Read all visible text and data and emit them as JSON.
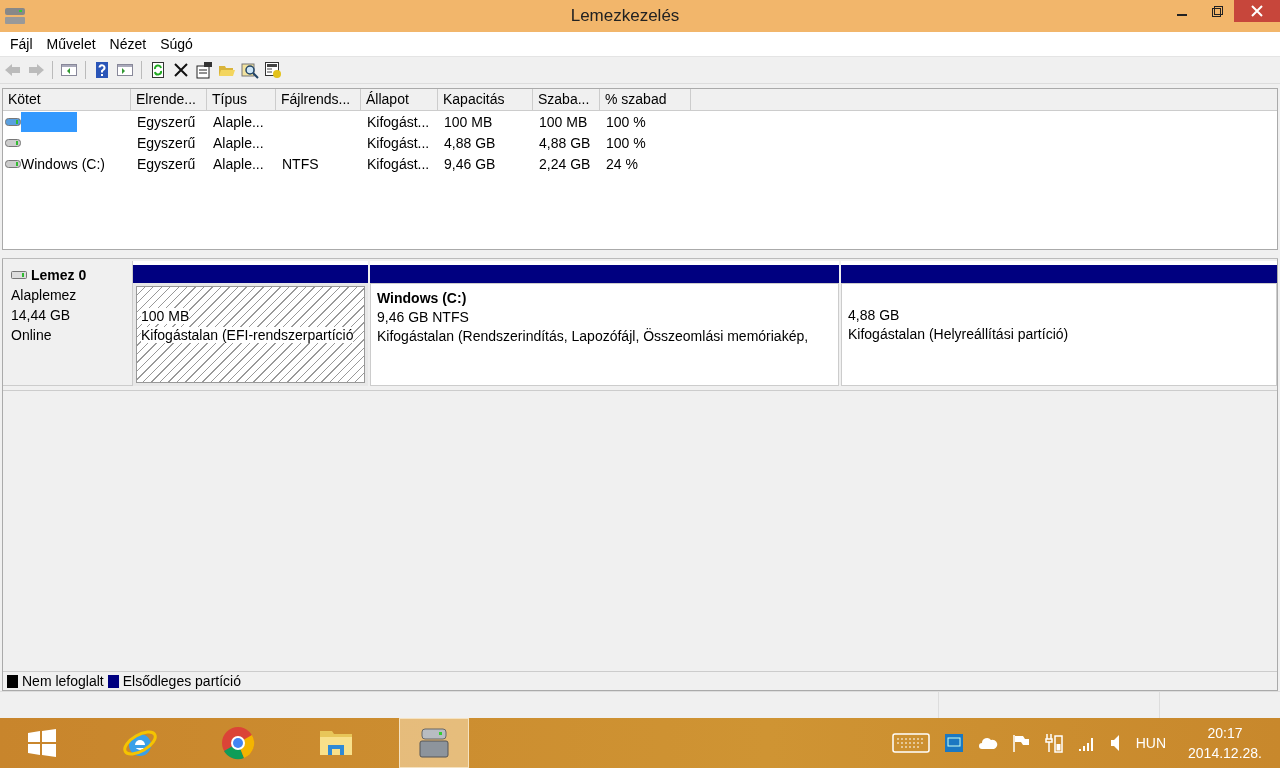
{
  "window": {
    "title": "Lemezkezelés"
  },
  "menu": [
    {
      "label": "Fájl"
    },
    {
      "label": "Művelet"
    },
    {
      "label": "Nézet"
    },
    {
      "label": "Súgó"
    }
  ],
  "toolbar": [
    {
      "kind": "back",
      "disabled": true
    },
    {
      "kind": "forward",
      "disabled": true
    },
    {
      "kind": "sep"
    },
    {
      "kind": "tree",
      "disabled": false
    },
    {
      "kind": "sep"
    },
    {
      "kind": "help",
      "disabled": false
    },
    {
      "kind": "pane",
      "disabled": false
    },
    {
      "kind": "sep"
    },
    {
      "kind": "refresh",
      "disabled": false
    },
    {
      "kind": "delete",
      "disabled": false
    },
    {
      "kind": "properties",
      "disabled": false
    },
    {
      "kind": "open",
      "disabled": false
    },
    {
      "kind": "explore",
      "disabled": false
    },
    {
      "kind": "helptopic",
      "disabled": false
    }
  ],
  "table": {
    "columns": [
      "Kötet",
      "Elrende...",
      "Típus",
      "Fájlrends...",
      "Állapot",
      "Kapacitás",
      "Szaba...",
      "% szabad"
    ],
    "rows": [
      {
        "selected": true,
        "cells": [
          "",
          "Egyszerű",
          "Alaple...",
          "",
          "Kifogást...",
          "100 MB",
          "100 MB",
          "100 %"
        ]
      },
      {
        "selected": false,
        "cells": [
          "",
          "Egyszerű",
          "Alaple...",
          "",
          "Kifogást...",
          "4,88 GB",
          "4,88 GB",
          "100 %"
        ]
      },
      {
        "selected": false,
        "cells": [
          "Windows (C:)",
          "Egyszerű",
          "Alaple...",
          "NTFS",
          "Kifogást...",
          "9,46 GB",
          "2,24 GB",
          "24 %"
        ]
      }
    ]
  },
  "disk": {
    "name": "Lemez 0",
    "type": "Alaplemez",
    "size": "14,44 GB",
    "status": "Online",
    "partitions": [
      {
        "selected": true,
        "color": "#000080",
        "size": "100 MB",
        "status": "Kifogástalan (EFI-rendszerpartíció"
      },
      {
        "selected": false,
        "color": "#000080",
        "name": "Windows  (C:)",
        "size": "9,46 GB NTFS",
        "status": "Kifogástalan (Rendszerindítás, Lapozófájl, Összeomlási memóriakép,"
      },
      {
        "selected": false,
        "color": "#000080",
        "size": "4,88 GB",
        "status": "Kifogástalan (Helyreállítási partíció)"
      }
    ]
  },
  "legend": [
    {
      "label": "Nem lefoglalt",
      "color": "#000000"
    },
    {
      "label": "Elsődleges partíció",
      "color": "#000080"
    }
  ],
  "taskbar": {
    "apps": [
      {
        "kind": "start",
        "selected": false
      },
      {
        "kind": "ie",
        "selected": false
      },
      {
        "kind": "chrome",
        "selected": false
      },
      {
        "kind": "explorer",
        "selected": false
      },
      {
        "kind": "diskmgmt",
        "selected": true
      }
    ],
    "tray": {
      "language": "HUN",
      "time": "20:17",
      "date": "2014.12.28."
    }
  }
}
